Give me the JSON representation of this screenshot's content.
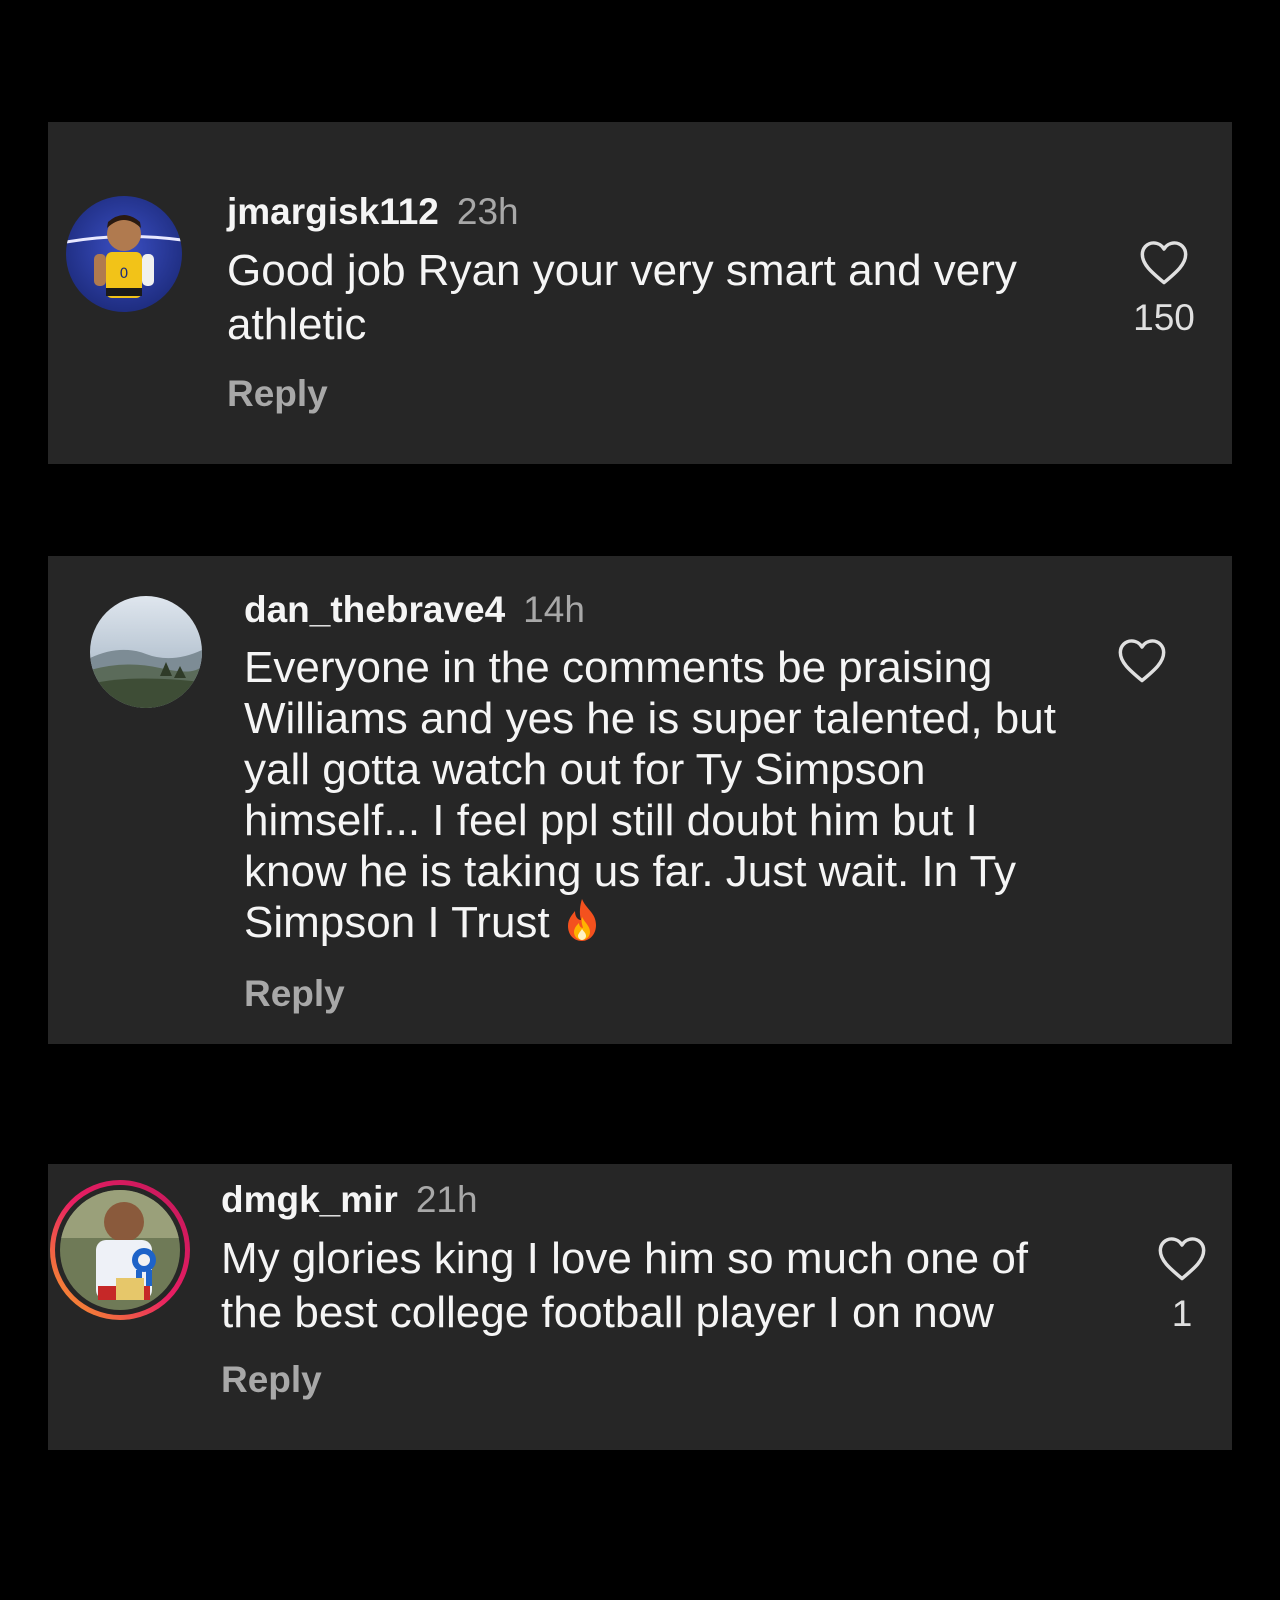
{
  "comments": [
    {
      "username": "jmargisk112",
      "time": "23h",
      "text_lines": [
        "Good job Ryan your very smart and very",
        "athletic"
      ],
      "reply_label": "Reply",
      "like_count": "150",
      "avatar_icon": "basketball-player-avatar"
    },
    {
      "username": "dan_thebrave4",
      "time": "14h",
      "text_lines": [
        "Everyone in the comments be praising",
        "Williams and yes he is super talented, but",
        "yall gotta watch out for Ty Simpson",
        "himself... I feel ppl still doubt him but I",
        "know he is taking us far. Just wait. In Ty",
        "Simpson I Trust"
      ],
      "emoji_icon": "fire-icon",
      "reply_label": "Reply",
      "like_count": "",
      "avatar_icon": "mountain-landscape-avatar"
    },
    {
      "username": "dmgk_mir",
      "time": "21h",
      "text_lines": [
        "My glories king I love him so much one of",
        "the best college football player I on now"
      ],
      "reply_label": "Reply",
      "like_count": "1",
      "avatar_icon": "child-photo-avatar-with-story-ring"
    }
  ],
  "colors": {
    "page_background": "#000000",
    "card_background": "#262626",
    "primary_text": "#f5f5f5",
    "secondary_text": "#a8a8a8",
    "story_ring_start": "#f9a825",
    "story_ring_end": "#c2185b"
  }
}
